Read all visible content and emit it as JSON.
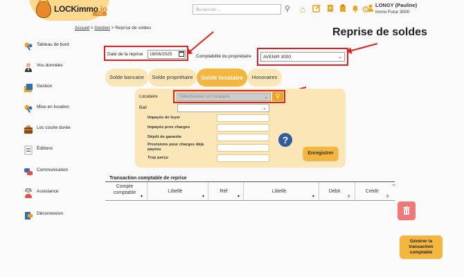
{
  "header": {
    "logo_text": "LOCKimmo",
    "logo_suffix": ".io",
    "logo_tag": "PRO",
    "search_placeholder": "Recherche ...",
    "user_name": "LONGY (Pauline)",
    "user_org": "Immo Futur 3000",
    "icons": [
      "home-icon",
      "edit-icon",
      "document-icon",
      "clipboard-icon",
      "bell-icon",
      "gear-icon",
      "user-icon"
    ]
  },
  "breadcrumb": {
    "home": "Accueil",
    "sep1": ">",
    "section": "Gestion",
    "sep2": ">",
    "current": "Reprise de soldes"
  },
  "page_title": "Reprise de soldes",
  "sidebar": {
    "items": [
      {
        "label": "Tableau de bord",
        "icon": "keys-icon"
      },
      {
        "label": "Vos données",
        "icon": "person-icon"
      },
      {
        "label": "Gestion",
        "icon": "folder-icon"
      },
      {
        "label": "Mise en location",
        "icon": "keys-icon"
      },
      {
        "label": "Loc courte durée",
        "icon": "suitcase-icon"
      },
      {
        "label": "Éditions",
        "icon": "document-icon"
      },
      {
        "label": "Communication",
        "icon": "chat-icon"
      },
      {
        "label": "Assistance",
        "icon": "support-icon"
      },
      {
        "label": "Déconnexion",
        "icon": "logout-icon"
      }
    ]
  },
  "form": {
    "date_label": "Date de la reprise",
    "date_value": "18/06/2025",
    "compta_label": "Comptabilité du propriétaire",
    "compta_value": "AVENIR 3000"
  },
  "tabs": [
    {
      "label": "Solde bancaire",
      "active": false
    },
    {
      "label": "Solde propriétaire",
      "active": false
    },
    {
      "label": "Solde locataire",
      "active": true
    },
    {
      "label": "Honoraires",
      "active": false
    }
  ],
  "panel": {
    "locataire_label": "Locataire",
    "locataire_placeholder": "Sélectionnez un locataire",
    "bail_label": "Bail",
    "fields": [
      "Impayés de loyer",
      "Impayés prov charges",
      "Dépôt de garantie",
      "Provisions pour charges déjà payées",
      "Trop perçu"
    ],
    "help_symbol": "?",
    "save_label": "Enregistrer"
  },
  "transaction": {
    "title": "Transaction comptable de reprise",
    "columns": [
      "Compte comptable",
      "Libellé",
      "Réf",
      "Libellé",
      "Débit",
      "Crédit"
    ]
  },
  "actions": {
    "generate_label": "Générer la transaction comptable"
  },
  "colors": {
    "accent": "#f5b640",
    "accent_light": "#fbe6b8",
    "highlight": "#e02020",
    "delete": "#f07878",
    "help": "#2f5c9e"
  }
}
